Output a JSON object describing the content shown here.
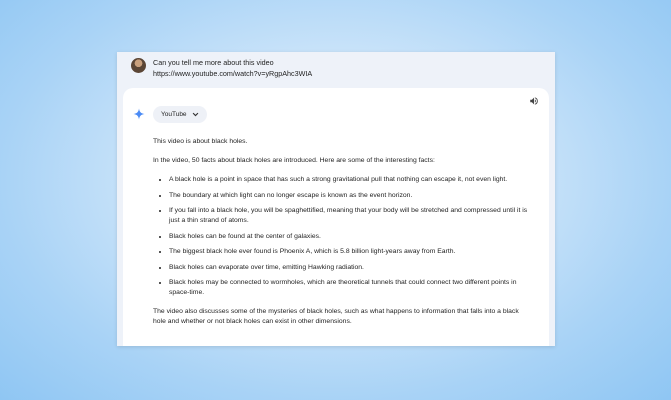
{
  "user": {
    "line1": "Can you tell me more about this video",
    "line2": "https://www.youtube.com/watch?v=yRgpAhc3WIA"
  },
  "response": {
    "chip_label": "YouTube",
    "intro": "This video is about black holes.",
    "lead": "In the video, 50 facts about black holes are introduced. Here are some of the interesting facts:",
    "facts": [
      "A black hole is a point in space that has such a strong gravitational pull that nothing can escape it, not even light.",
      "The boundary at which light can no longer escape is known as the event horizon.",
      "If you fall into a black hole, you will be spaghettified, meaning that your body will be stretched and compressed until it is just a thin strand of atoms.",
      "Black holes can be found at the center of galaxies.",
      "The biggest black hole ever found is Phoenix A, which is 5.8 billion light-years away from Earth.",
      "Black holes can evaporate over time, emitting Hawking radiation.",
      "Black holes may be connected to wormholes, which are theoretical tunnels that could connect two different points in space-time."
    ],
    "closing": "The video also discusses some of the mysteries of black holes, such as what happens to information that falls into a black hole and whether or not black holes can exist in other dimensions."
  },
  "icons": {
    "speaker": "speaker-icon",
    "spark": "gemini-spark-icon",
    "chevron": "chevron-down-icon"
  },
  "colors": {
    "accent": "#4285f4",
    "background": "#a9d3f6"
  }
}
